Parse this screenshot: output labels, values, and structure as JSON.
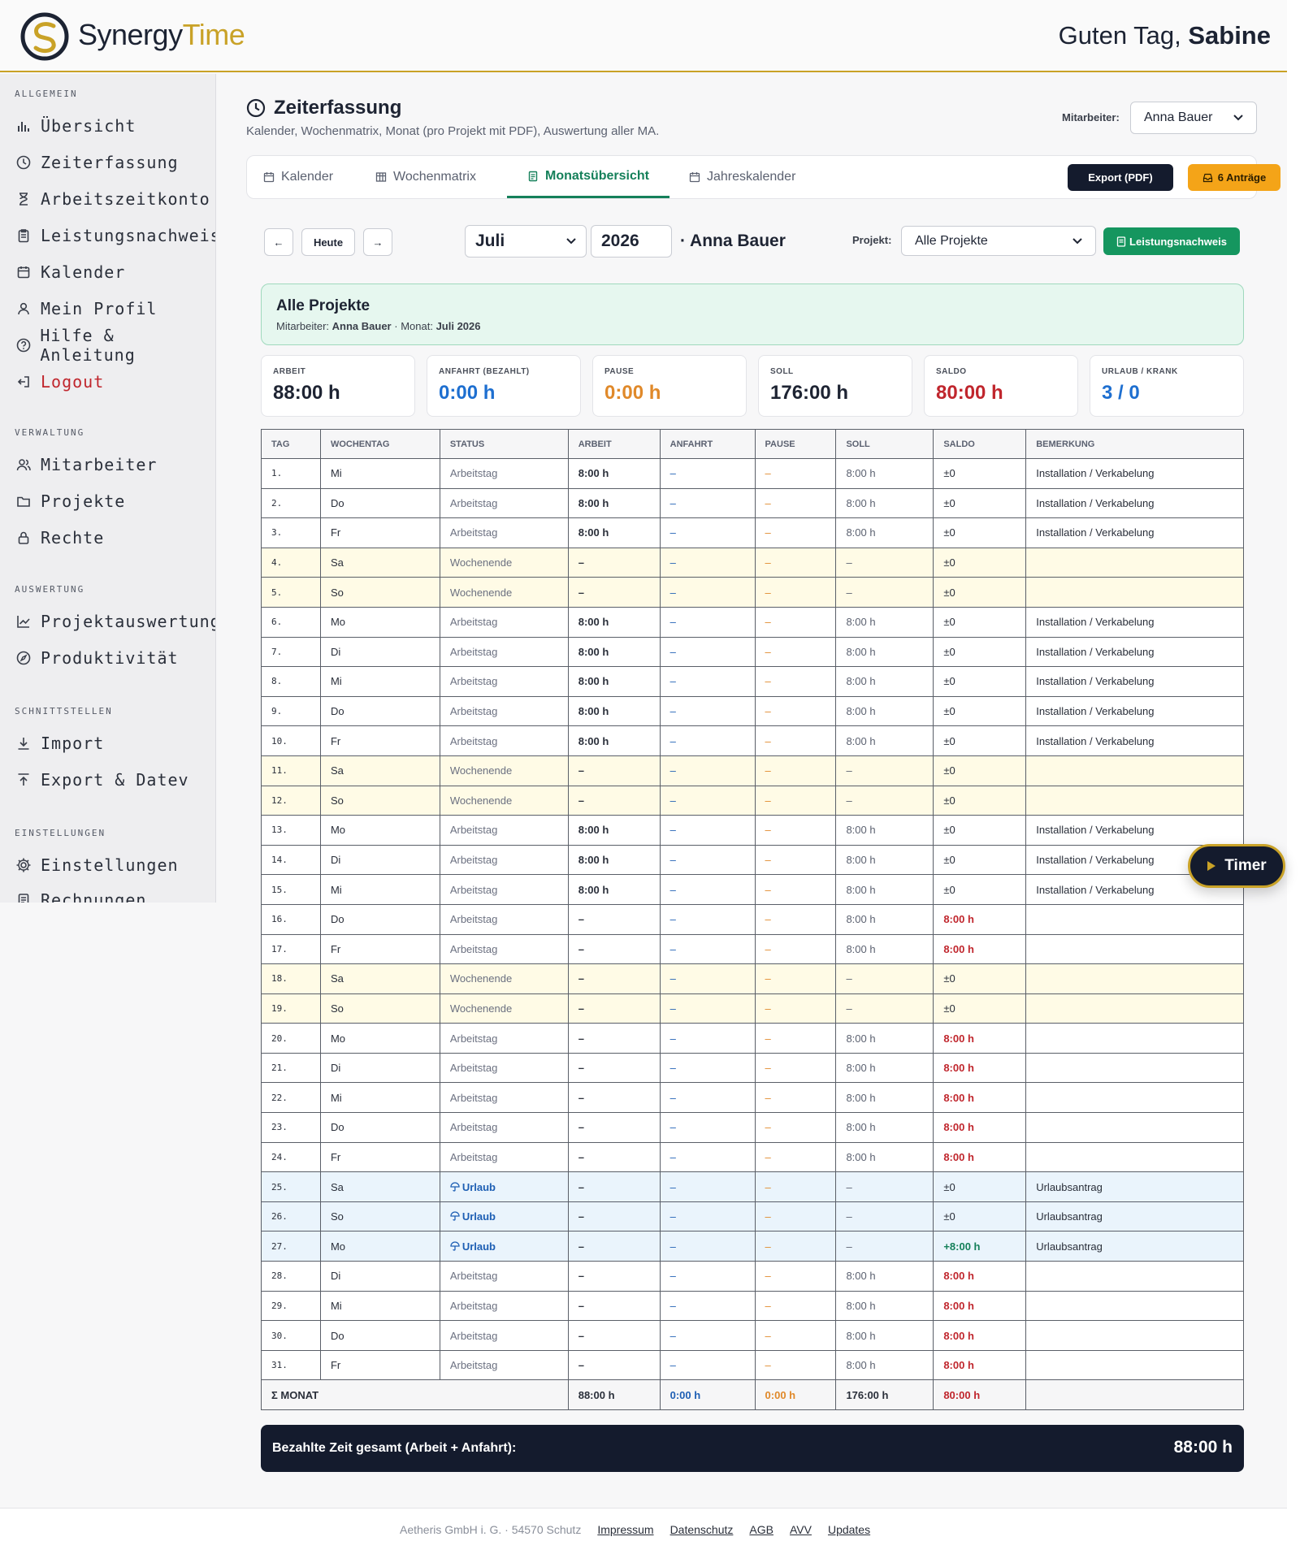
{
  "header": {
    "logo_text_main": "Synergy",
    "logo_text_accent": "Time",
    "greeting_prefix": "Guten Tag,",
    "greeting_name": "Sabine"
  },
  "sidebar": {
    "sections": [
      {
        "title": "ALLGEMEIN",
        "items": [
          {
            "label": "Übersicht",
            "icon": "bar-chart-icon"
          },
          {
            "label": "Zeiterfassung",
            "icon": "clock-icon"
          },
          {
            "label": "Arbeitszeitkonto",
            "icon": "hourglass-icon"
          },
          {
            "label": "Leistungsnachweis",
            "icon": "clipboard-icon"
          },
          {
            "label": "Kalender",
            "icon": "calendar-icon"
          },
          {
            "label": "Mein Profil",
            "icon": "user-icon"
          },
          {
            "label": "Hilfe & Anleitung",
            "icon": "help-icon"
          },
          {
            "label": "Logout",
            "icon": "logout-icon"
          }
        ]
      },
      {
        "title": "VERWALTUNG",
        "items": [
          {
            "label": "Mitarbeiter",
            "icon": "users-icon"
          },
          {
            "label": "Projekte",
            "icon": "folder-icon"
          },
          {
            "label": "Rechte",
            "icon": "lock-icon"
          }
        ]
      },
      {
        "title": "AUSWERTUNG",
        "items": [
          {
            "label": "Projektauswertung",
            "icon": "line-chart-icon"
          },
          {
            "label": "Produktivität",
            "icon": "compass-icon"
          }
        ]
      },
      {
        "title": "SCHNITTSTELLEN",
        "items": [
          {
            "label": "Import",
            "icon": "download-icon"
          },
          {
            "label": "Export & Datev",
            "icon": "upload-icon"
          }
        ]
      },
      {
        "title": "EINSTELLUNGEN",
        "items": [
          {
            "label": "Einstellungen",
            "icon": "gear-icon"
          },
          {
            "label": "Rechnungen",
            "icon": "invoice-icon"
          }
        ]
      }
    ]
  },
  "page": {
    "title": "Zeiterfassung",
    "subtitle": "Kalender, Wochenmatrix, Monat (pro Projekt mit PDF), Auswertung aller MA.",
    "employee_label": "Mitarbeiter:",
    "employee_value": "Anna Bauer"
  },
  "tabs": [
    {
      "label": "Kalender",
      "icon": "calendar-icon"
    },
    {
      "label": "Wochenmatrix",
      "icon": "grid-icon"
    },
    {
      "label": "Monatsübersicht",
      "icon": "document-icon",
      "active": true
    },
    {
      "label": "Jahreskalender",
      "icon": "calendar-icon"
    }
  ],
  "actions": {
    "export_label": "Export (PDF)",
    "requests_label": "6 Anträge"
  },
  "controls": {
    "prev": "←",
    "today": "Heute",
    "next": "→",
    "month": "Juli",
    "year": "2026",
    "employee_display": "· Anna Bauer",
    "project_label": "Projekt:",
    "project_value": "Alle Projekte",
    "proof_button": "Leistungsnachweis"
  },
  "summary": {
    "title": "Alle Projekte",
    "emp_label": "Mitarbeiter:",
    "emp_value": "Anna Bauer",
    "month_label": "· Monat:",
    "month_value": "Juli 2026"
  },
  "kpis": [
    {
      "label": "ARBEIT",
      "value": "88:00 h",
      "color": "#1e2433"
    },
    {
      "label": "ANFAHRT (BEZAHLT)",
      "value": "0:00 h",
      "color": "#1e6fd0"
    },
    {
      "label": "PAUSE",
      "value": "0:00 h",
      "color": "#e0892a"
    },
    {
      "label": "SOLL",
      "value": "176:00 h",
      "color": "#1e2433"
    },
    {
      "label": "SALDO",
      "value": "80:00 h",
      "color": "#c0262d"
    },
    {
      "label": "URLAUB / KRANK",
      "value": "3 / 0",
      "color": "#1e6fd0"
    }
  ],
  "table": {
    "headers": [
      "TAG",
      "WOCHENTAG",
      "STATUS",
      "ARBEIT",
      "ANFAHRT",
      "PAUSE",
      "SOLL",
      "SALDO",
      "BEMERKUNG"
    ],
    "rows": [
      {
        "tag": "1.",
        "wt": "Mi",
        "status": "Arbeitstag",
        "arbeit": "8:00 h",
        "anfahrt": "–",
        "pause": "–",
        "soll": "8:00 h",
        "saldo": "±0",
        "bem": "Installation / Verkabelung",
        "type": "work"
      },
      {
        "tag": "2.",
        "wt": "Do",
        "status": "Arbeitstag",
        "arbeit": "8:00 h",
        "anfahrt": "–",
        "pause": "–",
        "soll": "8:00 h",
        "saldo": "±0",
        "bem": "Installation / Verkabelung",
        "type": "work"
      },
      {
        "tag": "3.",
        "wt": "Fr",
        "status": "Arbeitstag",
        "arbeit": "8:00 h",
        "anfahrt": "–",
        "pause": "–",
        "soll": "8:00 h",
        "saldo": "±0",
        "bem": "Installation / Verkabelung",
        "type": "work"
      },
      {
        "tag": "4.",
        "wt": "Sa",
        "status": "Wochenende",
        "arbeit": "–",
        "anfahrt": "–",
        "pause": "–",
        "soll": "–",
        "saldo": "±0",
        "bem": "",
        "type": "we"
      },
      {
        "tag": "5.",
        "wt": "So",
        "status": "Wochenende",
        "arbeit": "–",
        "anfahrt": "–",
        "pause": "–",
        "soll": "–",
        "saldo": "±0",
        "bem": "",
        "type": "we"
      },
      {
        "tag": "6.",
        "wt": "Mo",
        "status": "Arbeitstag",
        "arbeit": "8:00 h",
        "anfahrt": "–",
        "pause": "–",
        "soll": "8:00 h",
        "saldo": "±0",
        "bem": "Installation / Verkabelung",
        "type": "work"
      },
      {
        "tag": "7.",
        "wt": "Di",
        "status": "Arbeitstag",
        "arbeit": "8:00 h",
        "anfahrt": "–",
        "pause": "–",
        "soll": "8:00 h",
        "saldo": "±0",
        "bem": "Installation / Verkabelung",
        "type": "work"
      },
      {
        "tag": "8.",
        "wt": "Mi",
        "status": "Arbeitstag",
        "arbeit": "8:00 h",
        "anfahrt": "–",
        "pause": "–",
        "soll": "8:00 h",
        "saldo": "±0",
        "bem": "Installation / Verkabelung",
        "type": "work"
      },
      {
        "tag": "9.",
        "wt": "Do",
        "status": "Arbeitstag",
        "arbeit": "8:00 h",
        "anfahrt": "–",
        "pause": "–",
        "soll": "8:00 h",
        "saldo": "±0",
        "bem": "Installation / Verkabelung",
        "type": "work"
      },
      {
        "tag": "10.",
        "wt": "Fr",
        "status": "Arbeitstag",
        "arbeit": "8:00 h",
        "anfahrt": "–",
        "pause": "–",
        "soll": "8:00 h",
        "saldo": "±0",
        "bem": "Installation / Verkabelung",
        "type": "work"
      },
      {
        "tag": "11.",
        "wt": "Sa",
        "status": "Wochenende",
        "arbeit": "–",
        "anfahrt": "–",
        "pause": "–",
        "soll": "–",
        "saldo": "±0",
        "bem": "",
        "type": "we"
      },
      {
        "tag": "12.",
        "wt": "So",
        "status": "Wochenende",
        "arbeit": "–",
        "anfahrt": "–",
        "pause": "–",
        "soll": "–",
        "saldo": "±0",
        "bem": "",
        "type": "we"
      },
      {
        "tag": "13.",
        "wt": "Mo",
        "status": "Arbeitstag",
        "arbeit": "8:00 h",
        "anfahrt": "–",
        "pause": "–",
        "soll": "8:00 h",
        "saldo": "±0",
        "bem": "Installation / Verkabelung",
        "type": "work"
      },
      {
        "tag": "14.",
        "wt": "Di",
        "status": "Arbeitstag",
        "arbeit": "8:00 h",
        "anfahrt": "–",
        "pause": "–",
        "soll": "8:00 h",
        "saldo": "±0",
        "bem": "Installation / Verkabelung",
        "type": "work"
      },
      {
        "tag": "15.",
        "wt": "Mi",
        "status": "Arbeitstag",
        "arbeit": "8:00 h",
        "anfahrt": "–",
        "pause": "–",
        "soll": "8:00 h",
        "saldo": "±0",
        "bem": "Installation / Verkabelung",
        "type": "work"
      },
      {
        "tag": "16.",
        "wt": "Do",
        "status": "Arbeitstag",
        "arbeit": "–",
        "anfahrt": "–",
        "pause": "–",
        "soll": "8:00 h",
        "saldo": "8:00 h",
        "bem": "",
        "type": "miss"
      },
      {
        "tag": "17.",
        "wt": "Fr",
        "status": "Arbeitstag",
        "arbeit": "–",
        "anfahrt": "–",
        "pause": "–",
        "soll": "8:00 h",
        "saldo": "8:00 h",
        "bem": "",
        "type": "miss"
      },
      {
        "tag": "18.",
        "wt": "Sa",
        "status": "Wochenende",
        "arbeit": "–",
        "anfahrt": "–",
        "pause": "–",
        "soll": "–",
        "saldo": "±0",
        "bem": "",
        "type": "we"
      },
      {
        "tag": "19.",
        "wt": "So",
        "status": "Wochenende",
        "arbeit": "–",
        "anfahrt": "–",
        "pause": "–",
        "soll": "–",
        "saldo": "±0",
        "bem": "",
        "type": "we"
      },
      {
        "tag": "20.",
        "wt": "Mo",
        "status": "Arbeitstag",
        "arbeit": "–",
        "anfahrt": "–",
        "pause": "–",
        "soll": "8:00 h",
        "saldo": "8:00 h",
        "bem": "",
        "type": "miss"
      },
      {
        "tag": "21.",
        "wt": "Di",
        "status": "Arbeitstag",
        "arbeit": "–",
        "anfahrt": "–",
        "pause": "–",
        "soll": "8:00 h",
        "saldo": "8:00 h",
        "bem": "",
        "type": "miss"
      },
      {
        "tag": "22.",
        "wt": "Mi",
        "status": "Arbeitstag",
        "arbeit": "–",
        "anfahrt": "–",
        "pause": "–",
        "soll": "8:00 h",
        "saldo": "8:00 h",
        "bem": "",
        "type": "miss"
      },
      {
        "tag": "23.",
        "wt": "Do",
        "status": "Arbeitstag",
        "arbeit": "–",
        "anfahrt": "–",
        "pause": "–",
        "soll": "8:00 h",
        "saldo": "8:00 h",
        "bem": "",
        "type": "miss"
      },
      {
        "tag": "24.",
        "wt": "Fr",
        "status": "Arbeitstag",
        "arbeit": "–",
        "anfahrt": "–",
        "pause": "–",
        "soll": "8:00 h",
        "saldo": "8:00 h",
        "bem": "",
        "type": "miss"
      },
      {
        "tag": "25.",
        "wt": "Sa",
        "status": "Urlaub",
        "arbeit": "–",
        "anfahrt": "–",
        "pause": "–",
        "soll": "–",
        "saldo": "±0",
        "bem": "Urlaubsantrag",
        "type": "ur"
      },
      {
        "tag": "26.",
        "wt": "So",
        "status": "Urlaub",
        "arbeit": "–",
        "anfahrt": "–",
        "pause": "–",
        "soll": "–",
        "saldo": "±0",
        "bem": "Urlaubsantrag",
        "type": "ur"
      },
      {
        "tag": "27.",
        "wt": "Mo",
        "status": "Urlaub",
        "arbeit": "–",
        "anfahrt": "–",
        "pause": "–",
        "soll": "–",
        "saldo": "+8:00 h",
        "bem": "Urlaubsantrag",
        "type": "urplus"
      },
      {
        "tag": "28.",
        "wt": "Di",
        "status": "Arbeitstag",
        "arbeit": "–",
        "anfahrt": "–",
        "pause": "–",
        "soll": "8:00 h",
        "saldo": "8:00 h",
        "bem": "",
        "type": "miss"
      },
      {
        "tag": "29.",
        "wt": "Mi",
        "status": "Arbeitstag",
        "arbeit": "–",
        "anfahrt": "–",
        "pause": "–",
        "soll": "8:00 h",
        "saldo": "8:00 h",
        "bem": "",
        "type": "miss"
      },
      {
        "tag": "30.",
        "wt": "Do",
        "status": "Arbeitstag",
        "arbeit": "–",
        "anfahrt": "–",
        "pause": "–",
        "soll": "8:00 h",
        "saldo": "8:00 h",
        "bem": "",
        "type": "miss"
      },
      {
        "tag": "31.",
        "wt": "Fr",
        "status": "Arbeitstag",
        "arbeit": "–",
        "anfahrt": "–",
        "pause": "–",
        "soll": "8:00 h",
        "saldo": "8:00 h",
        "bem": "",
        "type": "miss"
      }
    ],
    "sum": {
      "label": "Σ MONAT",
      "arbeit": "88:00 h",
      "anfahrt": "0:00 h",
      "pause": "0:00 h",
      "soll": "176:00 h",
      "saldo": "80:00 h"
    }
  },
  "paid": {
    "label": "Bezahlte Zeit gesamt (Arbeit + Anfahrt):",
    "value": "88:00 h"
  },
  "timer": {
    "label": "Timer"
  },
  "footer": {
    "company": "Aetheris GmbH i. G. · 54570 Schutz",
    "links": [
      "Impressum",
      "Datenschutz",
      "AGB",
      "AVV",
      "Updates"
    ]
  }
}
